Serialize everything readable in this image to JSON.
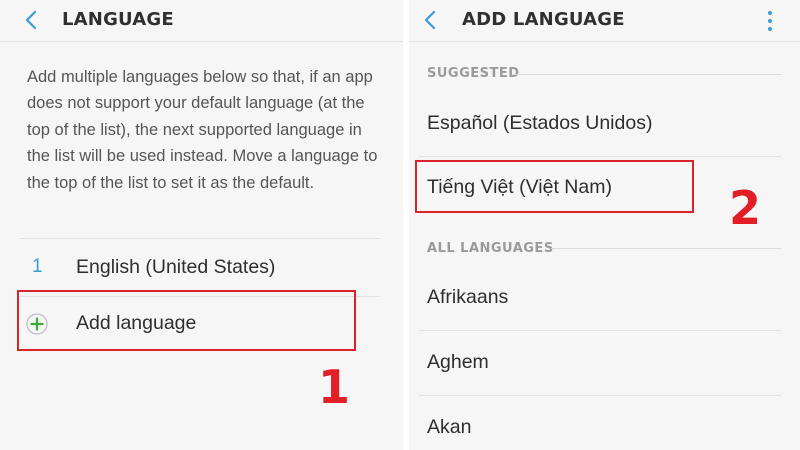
{
  "left_screen": {
    "header": {
      "title": "LANGUAGE",
      "back_icon": "chevron-left-icon"
    },
    "description": "Add multiple languages below so that, if an app does not support your default language (at the top of the list), the next supported language in the list will be used instead. Move a language to the top of the list to set it as the default.",
    "languages": [
      {
        "index": "1",
        "name": "English (United States)"
      }
    ],
    "add_language": {
      "label": "Add language",
      "icon": "plus-circle-icon"
    },
    "annotation_number": "1"
  },
  "right_screen": {
    "header": {
      "title": "ADD LANGUAGE",
      "back_icon": "chevron-left-icon",
      "menu_icon": "more-vertical-icon"
    },
    "suggested_label": "SUGGESTED",
    "suggested": [
      "Español (Estados Unidos)",
      "Tiếng Việt (Việt Nam)"
    ],
    "all_label": "ALL LANGUAGES",
    "all_languages": [
      "Afrikaans",
      "Aghem",
      "Akan"
    ],
    "annotation_number": "2"
  },
  "colors": {
    "accent": "#3b9bd6",
    "annotation": "#e21f26",
    "add_icon": "#3ea83a"
  }
}
